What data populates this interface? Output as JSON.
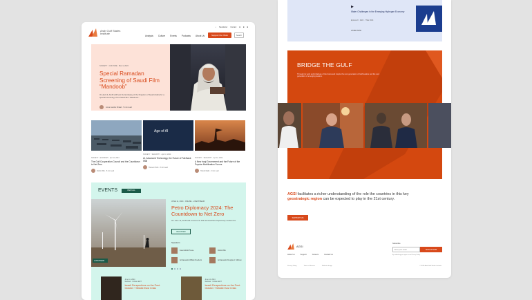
{
  "left": {
    "logo_text": "Arab Gulf States Institute",
    "topbar": [
      "Newsletter",
      "Contact"
    ],
    "nav": [
      "Analysis",
      "Culture",
      "Events",
      "Podcasts",
      "About Us"
    ],
    "support_label": "Support Our Work",
    "search_label": "Search",
    "hero": {
      "meta": "SOCIETY  ·  CULTURE  ·  Mar 4, 2024",
      "title": "Special Ramadan Screening of Saudi Film “Mandoob”",
      "desc": "On April 4, AGSI will host the Embassy of the Kingdom of Saudi Arabia for a special screening of the Saudi film “Mandoob.”",
      "author": "Anna Jacobs Khalaf  ·  5 min read"
    },
    "cards": [
      {
        "meta": "SOCIETY  ·  ECONOMY  ·  Apr 10, 2024",
        "title": "The Gulf Cooperation Council and the Countdown to Net Zero",
        "author": "Robin Mills  ·  5 min read",
        "img_text": ""
      },
      {
        "meta": "SOCIETY  ·  SECURITY  ·  Apr 10, 2024",
        "title": "AI, Advanced Technology, the Future of Fall-Back Wall",
        "author": "Hussein Ibish  ·  8 min read",
        "img_text": "Age of AI"
      },
      {
        "meta": "SOCIETY  ·  SECURITY  ·  Apr 12, 2024",
        "title": "A New Iraqi Government and the Future of the Popular Mobilization Forces",
        "author": "Hamdi Malik  ·  6 min read",
        "img_text": ""
      }
    ],
    "events": {
      "title": "EVENTS",
      "view_all": "VIEW ALL",
      "caption": "LIVESTREAM",
      "date": "JUNE 11, 2024  ·  ONLINE  ·  LIVESTREAM",
      "headline": "Petro Diplomacy 2024: The Countdown to Net Zero",
      "desc": "On June 11, AGSI will convene its 13th annual Petro Diplomacy conference.",
      "register": "REGISTER",
      "speakers_label": "Speakers",
      "speakers": [
        "Karen Elliott House",
        "Robin Mills",
        "Ambassador William Roebuck",
        "Ambassador Douglas A. Silliman"
      ],
      "mini": [
        {
          "date": "June 11, 2024",
          "meta": "Webinar  ·  9:00am EDT",
          "title": "Israeli Perspectives on the Post-October 7 Middle East Crisis"
        },
        {
          "date": "June 12, 2024",
          "meta": "Webinar  ·  9:00am EDT",
          "title": "Israeli Perspectives on the Post-October 7 Middle East Crisis"
        }
      ]
    }
  },
  "right": {
    "top_card": {
      "title": "Water Challenges in the Emerging Hydrogen Economy",
      "meta": "Episode 8  ·  2024  ·  7 Mar 2024",
      "link": "LISTEN NOW"
    },
    "bridge": {
      "title": "BRIDGE THE GULF",
      "desc": "Through its work and initiatives of the future and inspire the next generation of Gulf leaders and the next generation of emerging leaders."
    },
    "about": {
      "lead": "AGSI",
      "text_1": " facilitates a richer understanding of the role the countries in this key ",
      "highlight": "geostrategic region",
      "text_2": " can be expected to play in the 21st century."
    },
    "support_us": "SUPPORT US",
    "footer": {
      "logo": "AGSI",
      "links": [
        "About Us",
        "Support",
        "Careers",
        "Contact Us"
      ],
      "subscribe_label": "Subscribe",
      "email_placeholder": "Enter your email",
      "subscribe_btn": "SIGN UP NOW",
      "note": "By submitting you agree to our Privacy Policy",
      "bottom": [
        "Privacy Policy",
        "Terms of Service",
        "Website design"
      ],
      "copyright": "© 2024 Arab Gulf States Institute"
    }
  },
  "colors": {
    "accent": "#d8491b",
    "events_bg": "#d3f5ec",
    "hero_bg": "#fde2d8",
    "bridge_bg": "#d4480f"
  }
}
